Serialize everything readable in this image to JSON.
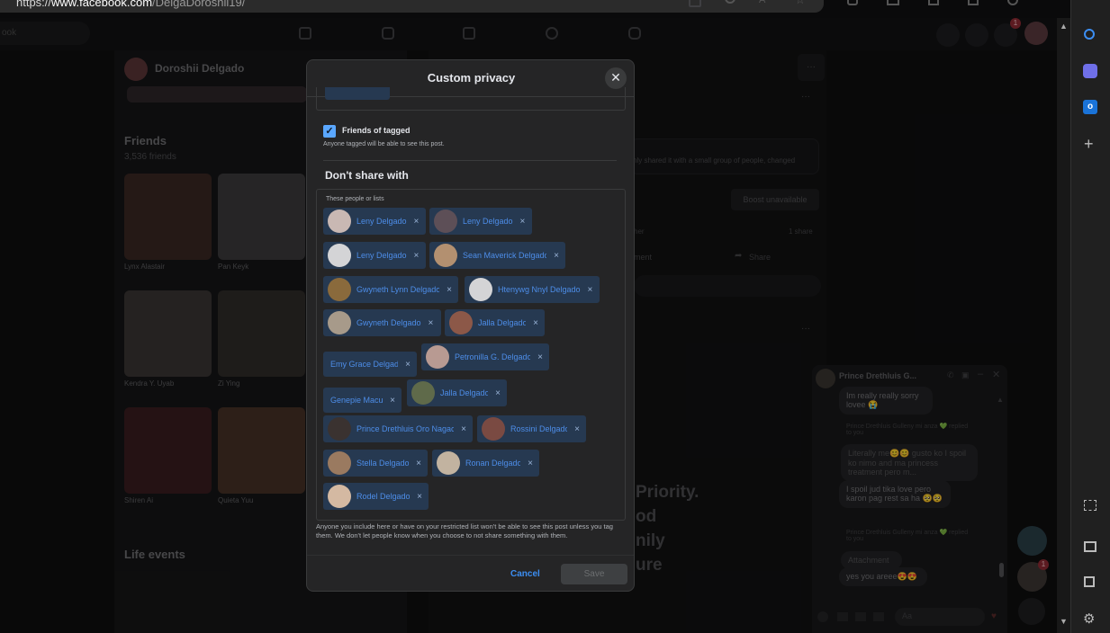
{
  "browser": {
    "url_prefix": "https://",
    "url_domain": "www.facebook.com",
    "url_path": "/DelgaDoroshii19/"
  },
  "background": {
    "search_placeholder": "ook",
    "profile_name": "Doroshii Delgado",
    "friends_heading": "Friends",
    "friends_count": "3,536 friends",
    "friends": [
      "Lynx Alastair",
      "Pan Keyk",
      "Kendra Y. Uyab",
      "Zi Ying",
      "Shiren Ai",
      "Quieta Yuu"
    ],
    "life_events_heading": "Life events",
    "post_notice": "nly shared it with a small group of people, changed",
    "boost_label": "Boost unavailable",
    "shares_count": "1 share",
    "comment_label": "ment",
    "share_label": "Share",
    "other_label": "her",
    "promo_text_lines": [
      "Priority.",
      "od",
      "nily",
      "ure"
    ],
    "notification_badge": "1"
  },
  "modal": {
    "title": "Custom privacy",
    "friends_of_tagged_label": "Friends of tagged",
    "friends_of_tagged_desc": "Anyone tagged will be able to see this post.",
    "friends_of_tagged_checked": true,
    "dont_share_heading": "Don't share with",
    "list_label": "These people or lists",
    "chips": [
      {
        "name": "Leny Delgado"
      },
      {
        "name": "Leny Delgado"
      },
      {
        "name": "Leny Delgado"
      },
      {
        "name": "Sean Maverick Delgado"
      },
      {
        "name": "Gwyneth Lynn Delgado"
      },
      {
        "name": "Htenywg Nnyl Delgado"
      },
      {
        "name": "Gwyneth Delgado"
      },
      {
        "name": "Jalla Delgado"
      },
      {
        "name": "Emy Grace Delgado"
      },
      {
        "name": "Petronilla G. Delgado"
      },
      {
        "name": "Genepie Macua"
      },
      {
        "name": "Jalla Delgado"
      },
      {
        "name": "Prince Drethluis Oro Nagac"
      },
      {
        "name": "Rossini Delgado"
      },
      {
        "name": "Stella Delgado"
      },
      {
        "name": "Ronan Delgado"
      },
      {
        "name": "Rodel Delgado"
      }
    ],
    "remove_glyph": "×",
    "footer_note": "Anyone you include here or have on your restricted list won't be able to see this post unless you tag them. We don't let people know when you choose to not share something with them.",
    "cancel_label": "Cancel",
    "save_label": "Save",
    "close_glyph": "✕"
  },
  "chat": {
    "contact_name": "Prince Drethluis G...",
    "messages": [
      "Im really really sorry lovee 😭",
      "Prince Drethluis Gulleny mi anza 💚 replied to you",
      "Literally me😊😊 gusto ko I spoil ko nimo and ma princess treatment pero m...",
      "I spoil jud tika love pero karon pag rest sa ha 🥺🥺",
      "Prince Drethluis Gulleny mi anza 💚 replied to you",
      "Attachment",
      "yes you areee😍😍"
    ],
    "input_placeholder": "Aa",
    "badge": "1"
  },
  "colors": {
    "accent": "#4d8de8",
    "chip_bg": "#263951",
    "modal_bg": "#252526",
    "checkbox": "#5aa7ff"
  }
}
